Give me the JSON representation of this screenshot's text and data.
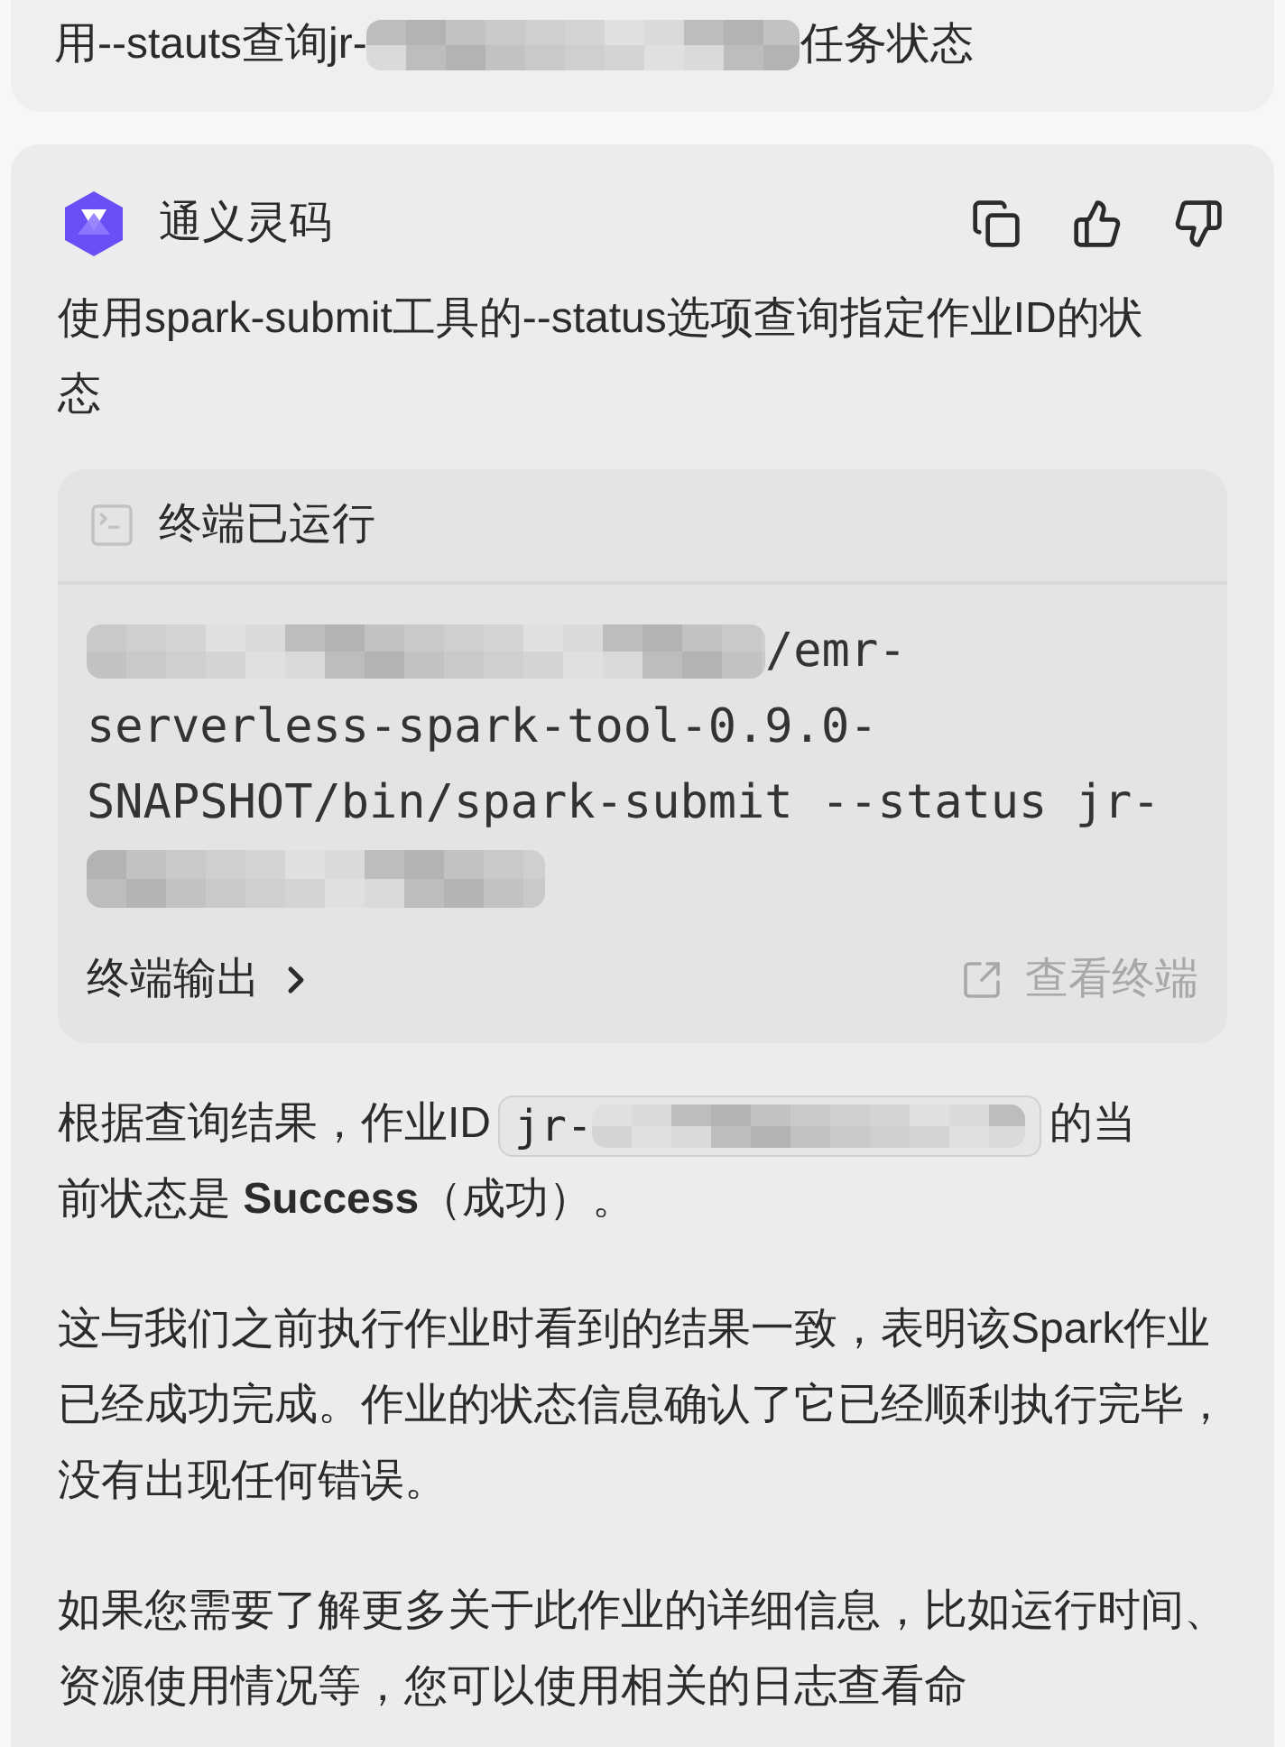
{
  "user_message": {
    "text_before": "用--stauts查询jr-",
    "text_after": "任务状态"
  },
  "assistant": {
    "name": "通义灵码",
    "intro": "使用spark-submit工具的--status选项查询指定作业ID的状态",
    "terminal": {
      "title": "终端已运行",
      "command_lines": [
        "/emr-",
        "serverless-spark-tool-0.9.0-",
        "SNAPSHOT/bin/spark-submit --status jr-"
      ],
      "output_label": "终端输出",
      "view_label": "查看终端"
    },
    "paragraphs": [
      {
        "kind": "code_ref",
        "before": "根据查询结果，作业ID",
        "code": "jr-",
        "after": [
          "的当",
          "前状态是 **Success**（成功）。"
        ]
      },
      {
        "kind": "plain",
        "text": "这与我们之前执行作业时看到的结果一致，表明该Spark作业已经成功完成。作业的状态信息确认了它已经顺利执行完毕，没有出现任何错误。"
      },
      {
        "kind": "plain",
        "text": "如果您需要了解更多关于此作业的详细信息，比如运行时间、资源使用情况等，您可以使用相关的日志查看命"
      }
    ]
  }
}
